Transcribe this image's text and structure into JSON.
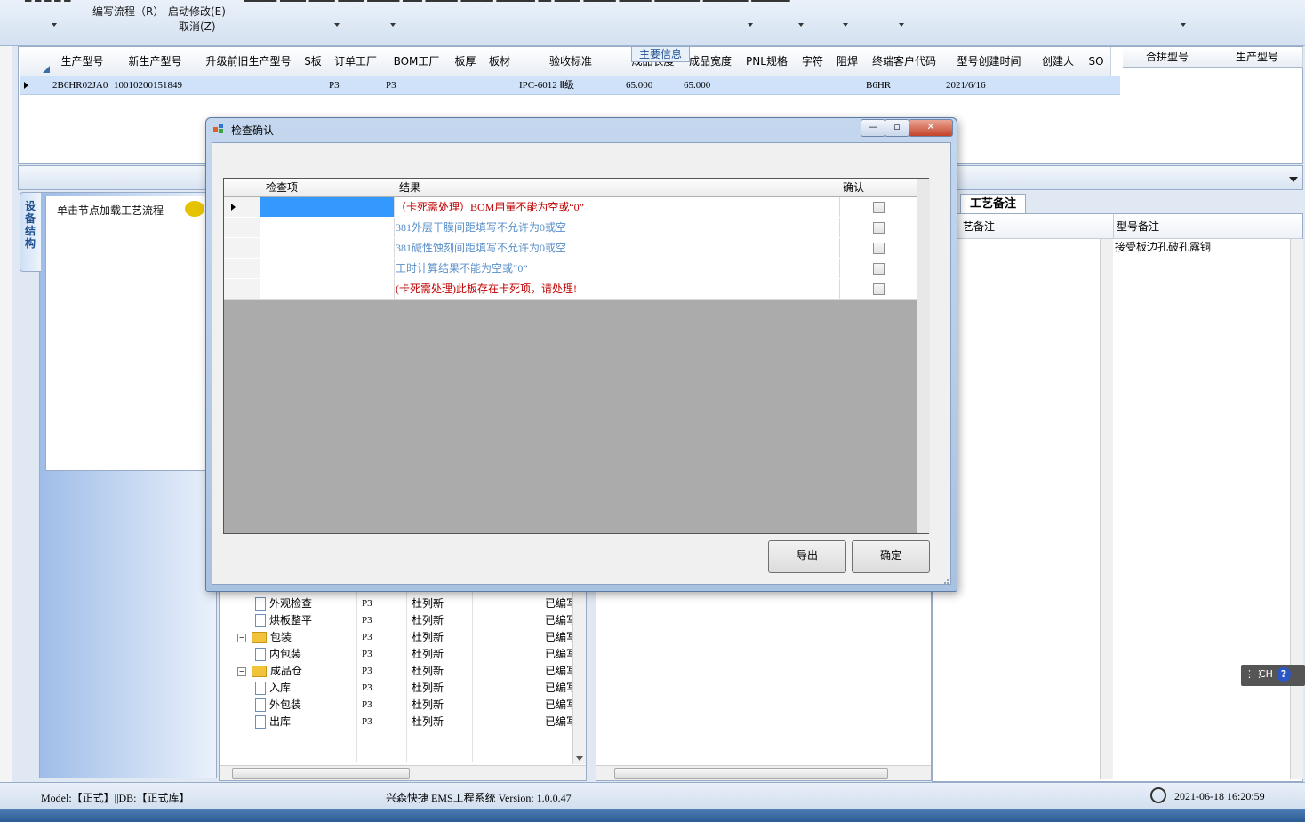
{
  "toolbar": {
    "items": [
      "编写流程（R）",
      "启动修改(E)",
      "取消(Z)"
    ]
  },
  "main_info": {
    "title": "主要信息",
    "columns": [
      "生产型号",
      "新生产型号",
      "升级前旧生产型号",
      "S板",
      "订单工厂",
      "BOM工厂",
      "板厚",
      "板材",
      "验收标准",
      "成品长度",
      "成品宽度",
      "PNL规格",
      "字符",
      "阻焊",
      "终端客户代码",
      "型号创建时间",
      "创建人",
      "SO"
    ],
    "row": {
      "model": "2B6HR02JA0",
      "new_model": "10010200151849",
      "order_factory": "P3",
      "bom_factory": "P3",
      "standard": "IPC-6012 Ⅱ级",
      "length": "65.000",
      "width": "65.000",
      "customer_code": "B6HR",
      "created": "2021/6/16"
    },
    "merge_columns": [
      "合拼型号",
      "生产型号"
    ]
  },
  "left_panel": {
    "vertical_tab": "设备结构",
    "node_hint": "单击节点加载工艺流程"
  },
  "tree": {
    "rows": [
      {
        "label": "外观检查",
        "factory": "P3",
        "person": "杜列新",
        "status": "已编写",
        "type": "doc"
      },
      {
        "label": "烘板整平",
        "factory": "P3",
        "person": "杜列新",
        "status": "已编写",
        "type": "doc"
      },
      {
        "label": "包装",
        "factory": "P3",
        "person": "杜列新",
        "status": "已编写",
        "type": "folder"
      },
      {
        "label": "内包装",
        "factory": "P3",
        "person": "杜列新",
        "status": "已编写",
        "type": "doc"
      },
      {
        "label": "成品仓",
        "factory": "P3",
        "person": "杜列新",
        "status": "已编写",
        "type": "folder"
      },
      {
        "label": "入库",
        "factory": "P3",
        "person": "杜列新",
        "status": "已编写",
        "type": "doc"
      },
      {
        "label": "外包装",
        "factory": "P3",
        "person": "杜列新",
        "status": "已编写",
        "type": "doc"
      },
      {
        "label": "出库",
        "factory": "P3",
        "person": "杜列新",
        "status": "已编写",
        "type": "doc"
      }
    ]
  },
  "notes": {
    "tab": "工艺备注",
    "col_left": "艺备注",
    "col_right": "型号备注",
    "model_note": "接受板边孔破孔露铜"
  },
  "dialog": {
    "title": "检查确认",
    "columns": [
      "检查项",
      "结果",
      "确认"
    ],
    "rows": [
      {
        "item": "",
        "result": "（卡死需处理）BOM用量不能为空或“0”",
        "color": "#c00000",
        "confirmed": false,
        "selected": true
      },
      {
        "item": "",
        "result": "381外层干膜间距填写不允许为0或空",
        "color": "#5a8fc8",
        "confirmed": false,
        "selected": false
      },
      {
        "item": "",
        "result": "381碱性蚀刻间距填写不允许为0或空",
        "color": "#5a8fc8",
        "confirmed": false,
        "selected": false
      },
      {
        "item": "",
        "result": "工时计算结果不能为空或“0”",
        "color": "#5a8fc8",
        "confirmed": false,
        "selected": false
      },
      {
        "item": "",
        "result": "(卡死需处理)此板存在卡死项，请处理!",
        "color": "#c00000",
        "confirmed": false,
        "selected": false
      }
    ],
    "export_label": "导出",
    "ok_label": "确定"
  },
  "status_bar": {
    "model_db": "Model:【正式】||DB:【正式库】",
    "app": "兴森快捷 EMS工程系统 Version: 1.0.0.47",
    "datetime": "2021-06-18 16:20:59"
  },
  "ime": {
    "label": "CH"
  },
  "colors": {
    "error": "#c00000",
    "warning": "#5a8fc8",
    "selection": "#3399ff"
  }
}
